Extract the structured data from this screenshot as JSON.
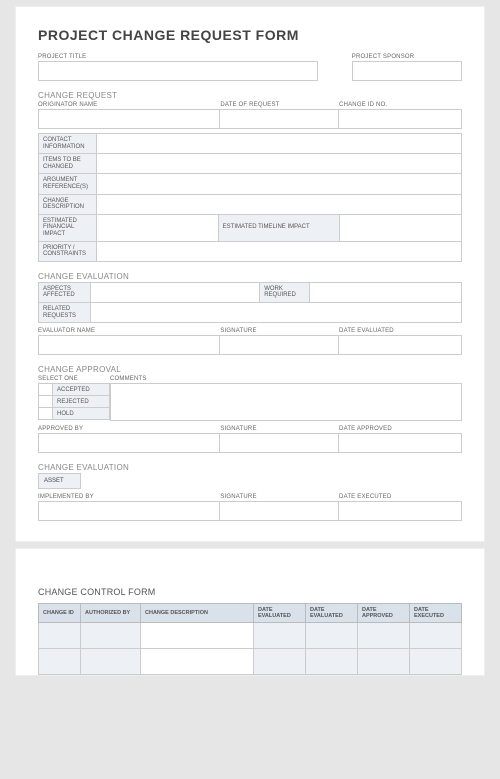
{
  "form": {
    "title": "PROJECT CHANGE REQUEST FORM",
    "project_title_label": "PROJECT TITLE",
    "project_sponsor_label": "PROJECT SPONSOR",
    "project_title": "",
    "project_sponsor": "",
    "change_request": {
      "heading": "CHANGE REQUEST",
      "originator_label": "ORIGINATOR NAME",
      "date_label": "DATE OF REQUEST",
      "change_id_label": "CHANGE ID NO.",
      "originator": "",
      "date": "",
      "change_id": "",
      "rows": {
        "contact_info": "CONTACT INFORMATION",
        "items_to_change": "ITEMS TO BE CHANGED",
        "argument_refs": "ARGUMENT REFERENCE(S)",
        "change_desc": "CHANGE DESCRIPTION",
        "est_fin_impact": "ESTIMATED FINANCIAL IMPACT",
        "est_time_impact": "ESTIMATED TIMELINE IMPACT",
        "priority": "PRIORITY / CONSTRAINTS"
      }
    },
    "evaluation": {
      "heading": "CHANGE EVALUATION",
      "aspects_label": "ASPECTS AFFECTED",
      "work_req_label": "WORK REQUIRED",
      "related_label": "RELATED REQUESTS",
      "evaluator_label": "EVALUATOR NAME",
      "signature_label": "SIGNATURE",
      "date_eval_label": "DATE EVALUATED"
    },
    "approval": {
      "heading": "CHANGE APPROVAL",
      "select_one_label": "SELECT ONE",
      "comments_label": "COMMENTS",
      "options": {
        "accepted": "ACCEPTED",
        "rejected": "REJECTED",
        "hold": "HOLD"
      },
      "approved_by_label": "APPROVED BY",
      "signature_label": "SIGNATURE",
      "date_approved_label": "DATE APPROVED"
    },
    "evaluation2": {
      "heading": "CHANGE EVALUATION",
      "asset_label": "ASSET",
      "implemented_by_label": "IMPLEMENTED BY",
      "signature_label": "SIGNATURE",
      "date_exec_label": "DATE EXECUTED"
    }
  },
  "ccf": {
    "title": "CHANGE CONTROL FORM",
    "headers": {
      "change_id": "CHANGE ID",
      "authorized_by": "AUTHORIZED BY",
      "change_desc": "CHANGE DESCRIPTION",
      "date_eval1": "DATE EVALUATED",
      "date_eval2": "DATE EVALUATED",
      "date_approved": "DATE APPROVED",
      "date_executed": "DATE EXECUTED"
    }
  }
}
